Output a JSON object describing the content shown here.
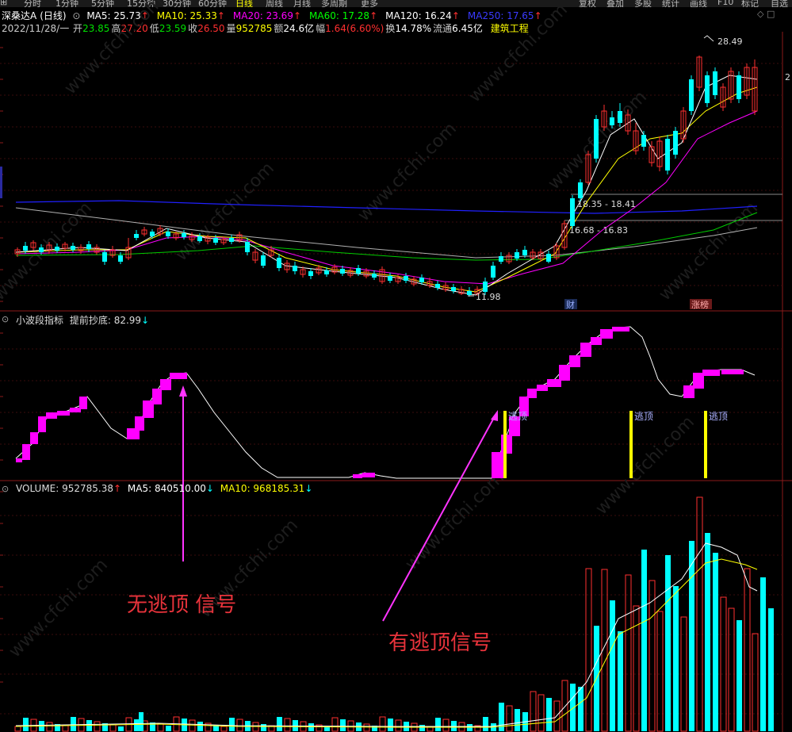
{
  "toolbar": {
    "period_tabs": [
      "分时",
      "1分钟",
      "5分钟",
      "15分钟",
      "30分钟",
      "60分钟",
      "日线",
      "周线",
      "月线",
      "多周期",
      "更多"
    ],
    "right_buttons": [
      "复权",
      "叠加",
      "多股",
      "统计",
      "画线",
      "F10",
      "标记",
      "自选"
    ]
  },
  "header": {
    "stock_name": "深桑达A",
    "period_label": "(日线)",
    "ma_items": [
      {
        "label": "MA5: 25.73",
        "arrow": "↑",
        "color": "#ffffff"
      },
      {
        "label": "MA10: 25.33",
        "arrow": "↑",
        "color": "#ffff00"
      },
      {
        "label": "MA20: 23.69",
        "arrow": "↑",
        "color": "#ff00ff"
      },
      {
        "label": "MA60: 17.28",
        "arrow": "↑",
        "color": "#00ff00"
      },
      {
        "label": "MA120: 16.24",
        "arrow": "↑",
        "color": "#ffffff"
      },
      {
        "label": "MA250: 17.65",
        "arrow": "↑",
        "color": "#3a3aff"
      }
    ],
    "info_date": "2022/11/28/一",
    "info_items": [
      {
        "label": "开",
        "value": "23.85",
        "color": "#00e000"
      },
      {
        "label": "高",
        "value": "27.20",
        "color": "#ff3030"
      },
      {
        "label": "低",
        "value": "23.59",
        "color": "#00e000"
      },
      {
        "label": "收",
        "value": "26.50",
        "color": "#ff3030"
      },
      {
        "label": "量",
        "value": "952785",
        "color": "#ffff00"
      },
      {
        "label": "额",
        "value": "24.6亿",
        "color": "#ffffff"
      },
      {
        "label": "幅",
        "value": "1.64(6.60%)",
        "color": "#ff3030"
      },
      {
        "label": "换",
        "value": "14.78%",
        "color": "#ffffff"
      },
      {
        "label": "流通",
        "value": "6.45亿",
        "color": "#ffffff"
      }
    ],
    "sector": "建筑工程"
  },
  "price_chart": {
    "high_label": "28.49",
    "low_label": "11.98",
    "range_labels": [
      "18.35 - 18.41",
      "16.68 - 16.83"
    ],
    "badges": [
      "财",
      "涨榜"
    ],
    "right_edge": "2"
  },
  "indicator": {
    "title": "小波段指标",
    "subtitle": "提前抄底: 82.99",
    "arrow": "↓",
    "signal_labels": [
      "逃顶",
      "逃顶",
      "逃顶"
    ]
  },
  "volume": {
    "title": "VOLUME: 952785.38",
    "title_arrow": "↑",
    "ma5": "MA5: 840510.00",
    "ma5_arrow": "↓",
    "ma10": "MA10: 968185.31",
    "ma10_arrow": "↓"
  },
  "annotations": {
    "no_signal": "无逃顶 信号",
    "has_signal": "有逃顶信号"
  },
  "watermark": "www.cfchi.com",
  "colors": {
    "up": "#ff3030",
    "down": "#00ffff",
    "signal": "#ffff00",
    "indicator": "#ff00ff",
    "annotation": "#e8333b"
  }
}
